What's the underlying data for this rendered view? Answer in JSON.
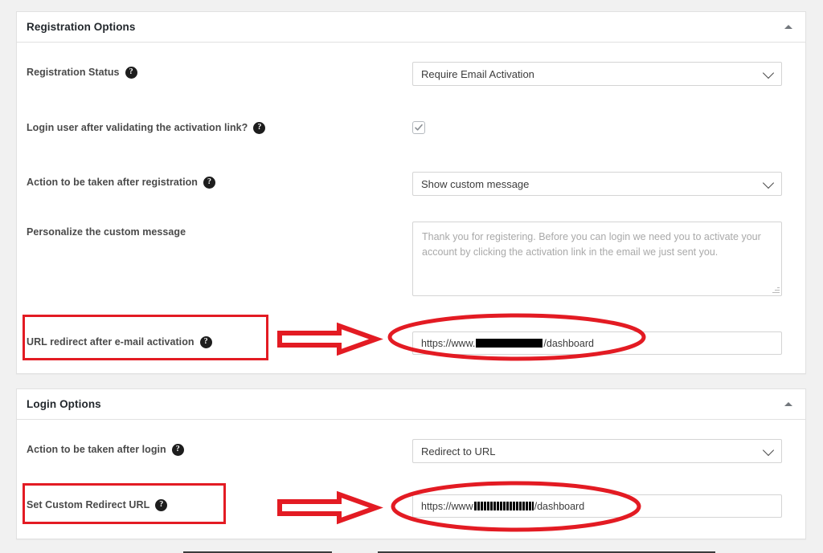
{
  "registration_section": {
    "title": "Registration Options",
    "collapse_icon": "caret-up-icon",
    "rows": [
      {
        "label": "Registration Status",
        "help_icon": "help-icon",
        "control": "select",
        "value": "Require Email Activation"
      },
      {
        "label": "Login user after validating the activation link?",
        "help_icon": "help-icon",
        "control": "checkbox",
        "checked": "checked"
      },
      {
        "label": "Action to be taken after registration",
        "help_icon": "help-icon",
        "control": "select",
        "value": "Show custom message"
      },
      {
        "label": "Personalize the custom message",
        "control": "textarea",
        "placeholder": "Thank you for registering. Before you can login we need you to activate your account by clicking the activation link in the email we just sent you."
      },
      {
        "label": "URL redirect after e-mail activation",
        "help_icon": "help-icon",
        "control": "text",
        "url_prefix": "https://www.",
        "url_redacted": "[redacted]",
        "url_suffix": "/dashboard",
        "highlighted": "true"
      }
    ]
  },
  "login_section": {
    "title": "Login Options",
    "collapse_icon": "caret-up-icon",
    "rows": [
      {
        "label": "Action to be taken after login",
        "help_icon": "help-icon",
        "control": "select",
        "value": "Redirect to URL"
      },
      {
        "label": "Set Custom Redirect URL",
        "help_icon": "help-icon",
        "control": "text",
        "url_prefix": "https://www",
        "url_redacted": "[redacted]",
        "url_suffix": "/dashboard",
        "highlighted": "true"
      }
    ]
  },
  "annotations": {
    "color": "#e31b23",
    "shapes": [
      "rect-url-redirect-label",
      "arrow-to-url-redirect-field",
      "ellipse-url-redirect-field",
      "rect-custom-redirect-label",
      "arrow-to-custom-redirect-field",
      "ellipse-custom-redirect-field"
    ]
  },
  "help_glyph": "?"
}
